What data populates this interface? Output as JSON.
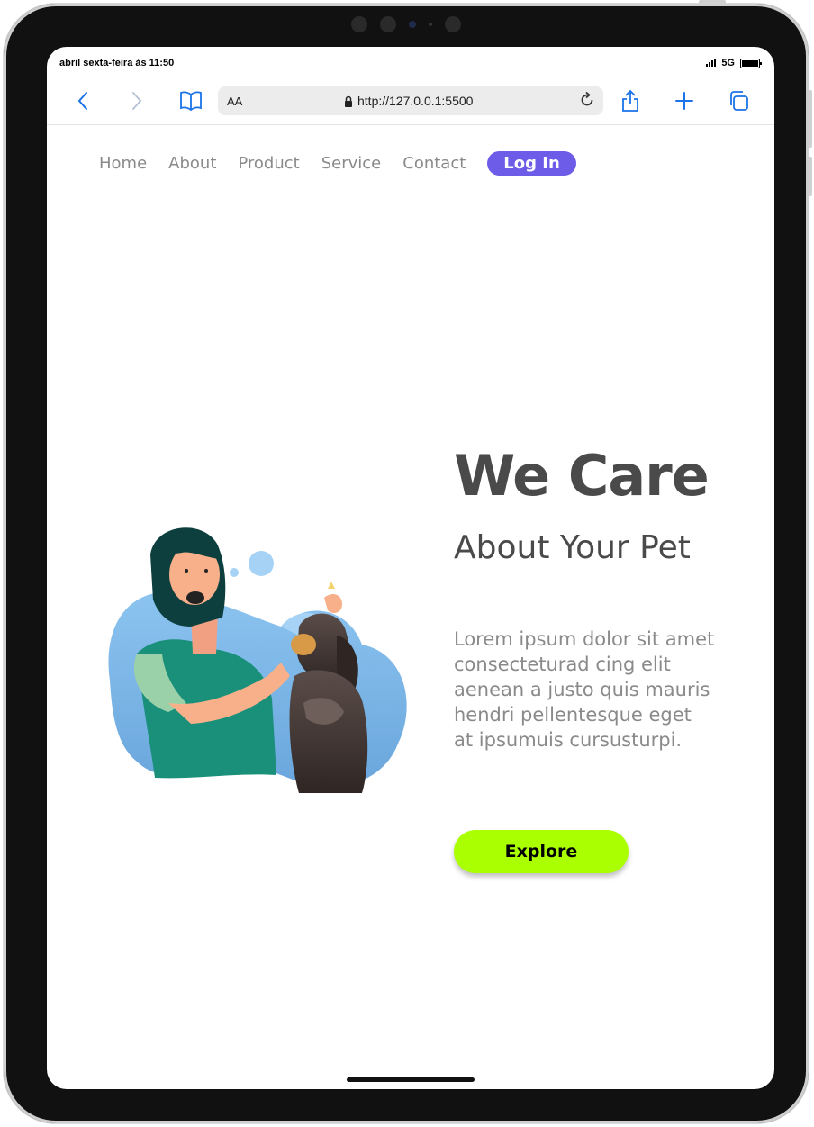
{
  "status": {
    "time": "abril sexta-feira às 11:50",
    "network": "5G"
  },
  "browser": {
    "text_size_label": "AA",
    "url": "http://127.0.0.1:5500"
  },
  "nav": {
    "items": [
      "Home",
      "About",
      "Product",
      "Service",
      "Contact"
    ],
    "login": "Log In"
  },
  "hero": {
    "title": "We Care",
    "subtitle": "About Your Pet",
    "body": "Lorem ipsum dolor sit amet consecteturad cing elit aenean a justo quis mauris hendri pellentesque eget at ipsumuis cursusturpi.",
    "cta": "Explore"
  },
  "colors": {
    "accent": "#6c5ce7",
    "cta": "#aaff00",
    "heading": "#4a4a4a",
    "muted": "#8a8a8a"
  },
  "icons": [
    "back-icon",
    "forward-icon",
    "bookmarks-icon",
    "lock-icon",
    "reload-icon",
    "share-icon",
    "new-tab-icon",
    "tabs-icon"
  ]
}
